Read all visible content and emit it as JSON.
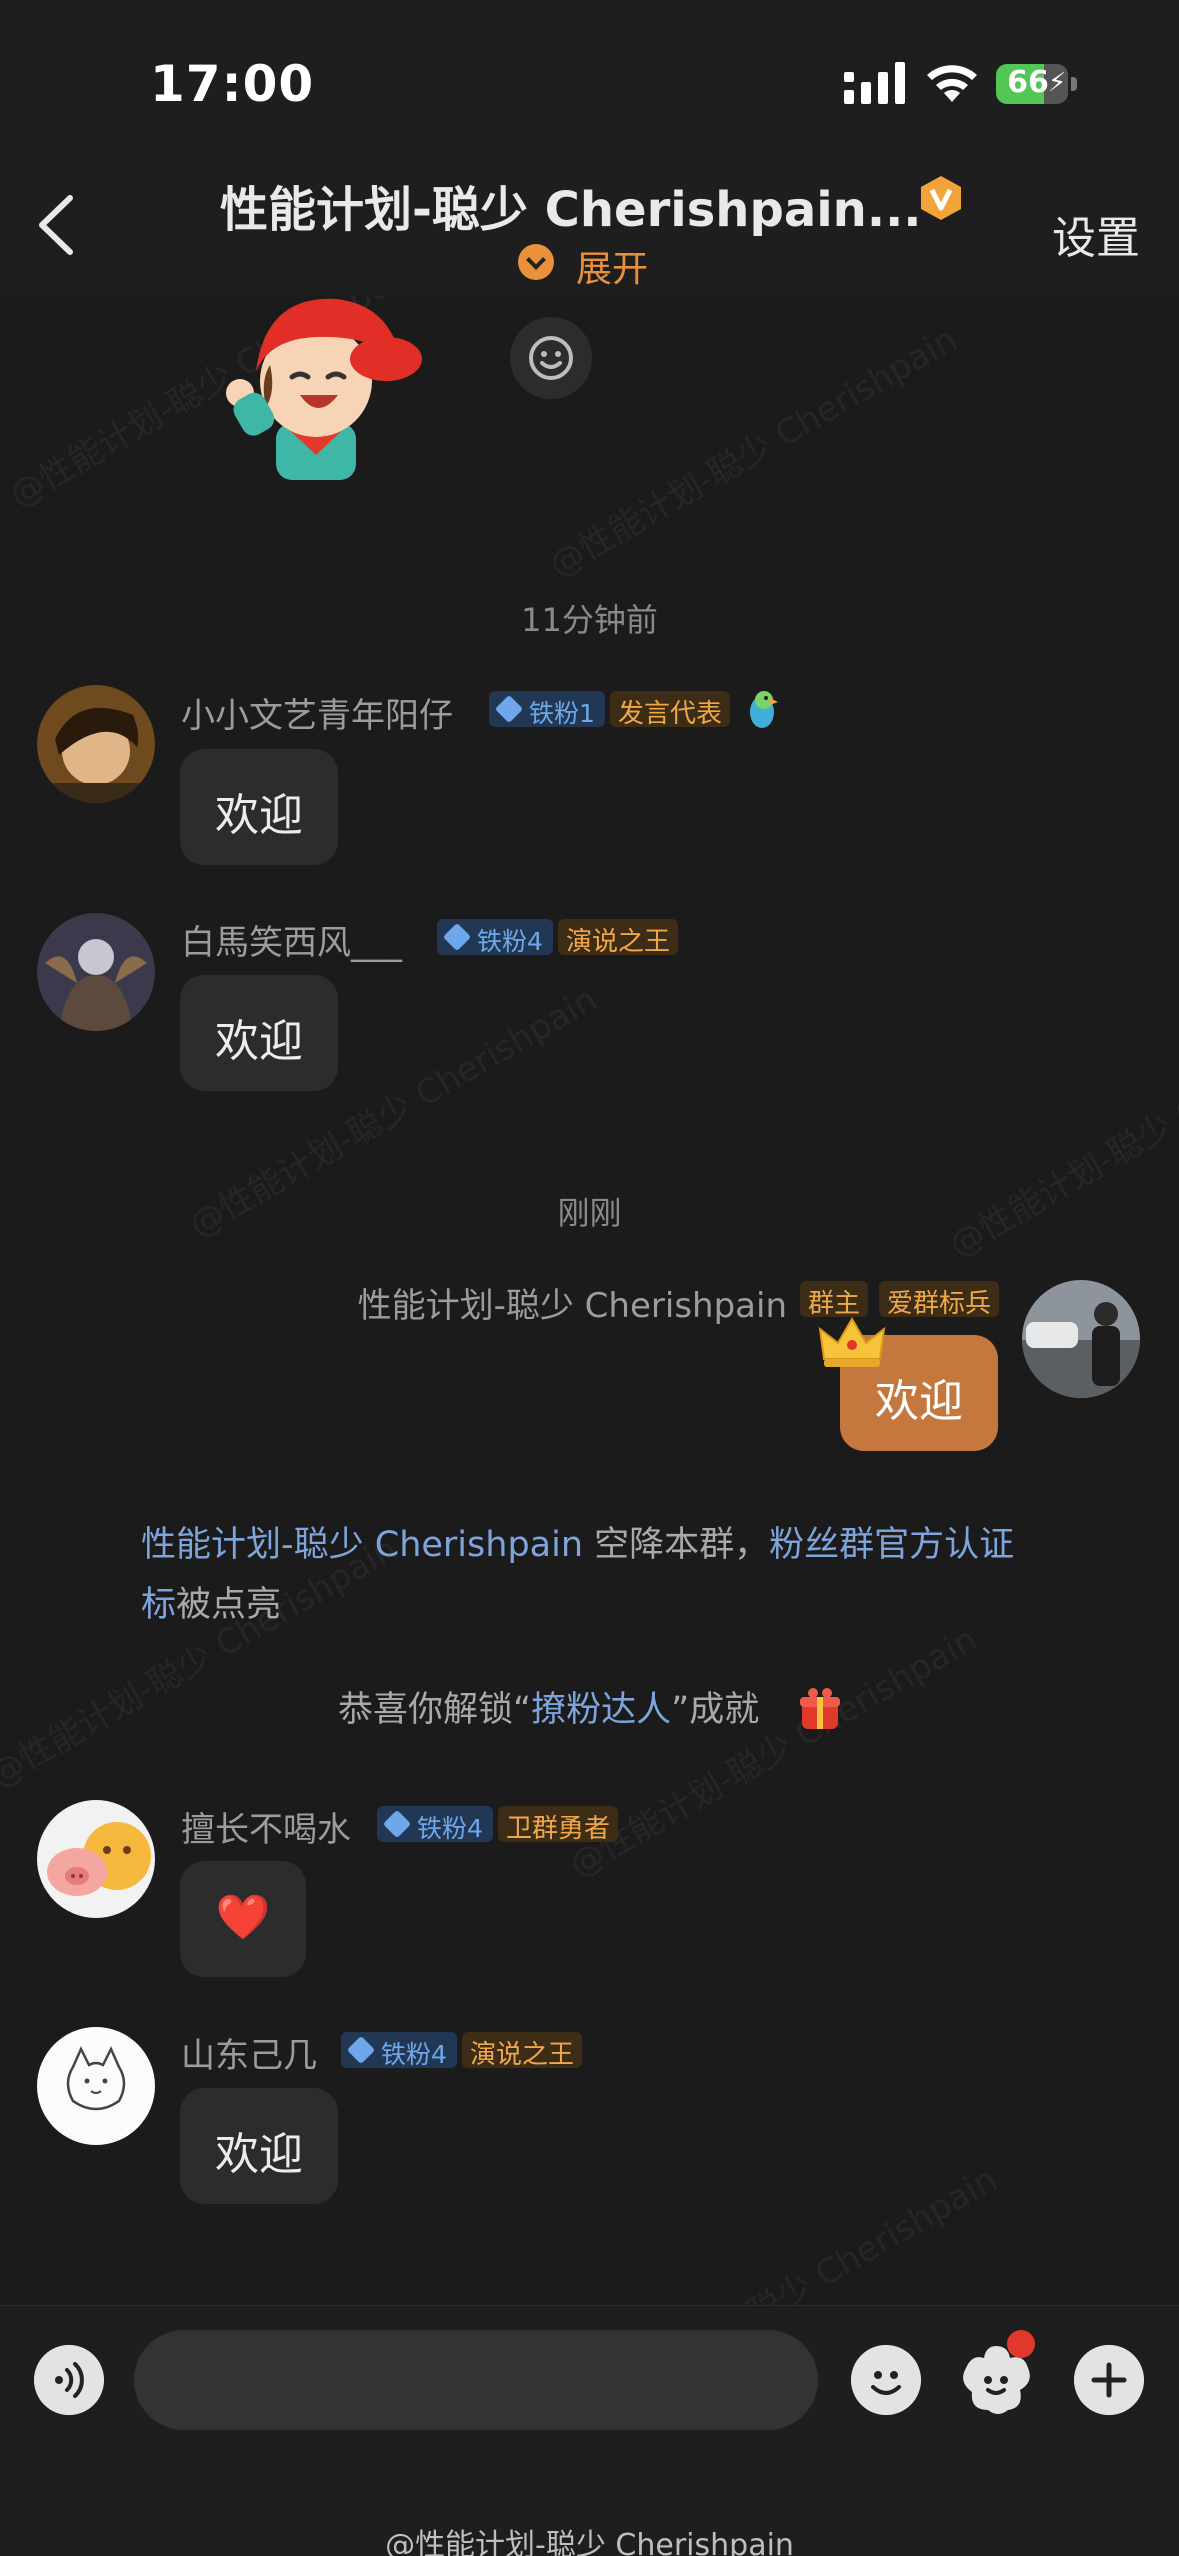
{
  "status_bar": {
    "time": "17:00",
    "battery_level": "66"
  },
  "header": {
    "title": "性能计划-聪少 Cherishpain...",
    "expand_label": "展开",
    "settings_label": "设置"
  },
  "watermark_text": "@性能计划-聪少 Cherishpain",
  "timestamps": {
    "first": "11分钟前",
    "second": "刚刚"
  },
  "messages": [
    {
      "username": "小小文艺青年阳仔",
      "fan_badge": "铁粉1",
      "title_badge": "发言代表",
      "text": "欢迎"
    },
    {
      "username": "白馬笑西风___",
      "fan_badge": "铁粉4",
      "title_badge": "演说之王",
      "text": "欢迎"
    },
    {
      "username": "性能计划-聪少 Cherishpain",
      "role_badge": "群主",
      "title_badge": "爱群标兵",
      "text": "欢迎"
    },
    {
      "username": "擅长不喝水",
      "fan_badge": "铁粉4",
      "title_badge": "卫群勇者",
      "text": "❤️"
    },
    {
      "username": "山东己几",
      "fan_badge": "铁粉4",
      "title_badge": "演说之王",
      "text": "欢迎"
    }
  ],
  "system": {
    "landing_name": "性能计划-聪少 Cherishpain",
    "landing_middle": " 空降本群，",
    "landing_link": "粉丝群官方认证",
    "landing_link_2": "标",
    "landing_end": "被点亮",
    "achievement_prefix": "恭喜你解锁“",
    "achievement_name": "撩粉达人",
    "achievement_suffix": "”成就"
  },
  "footer": {
    "watermark": "@性能计划-聪少 Cherishpain"
  },
  "icons": {
    "back": "chevron-left-icon",
    "vip": "vip-badge-icon",
    "voice": "voice-icon",
    "emoji": "emoji-icon",
    "sticker": "sticker-icon",
    "plus": "plus-icon"
  },
  "colors": {
    "accent": "#e8913a",
    "self_bubble": "#c4783e",
    "link": "#7ea4dc",
    "fan_badge": "#6fa8ea"
  }
}
